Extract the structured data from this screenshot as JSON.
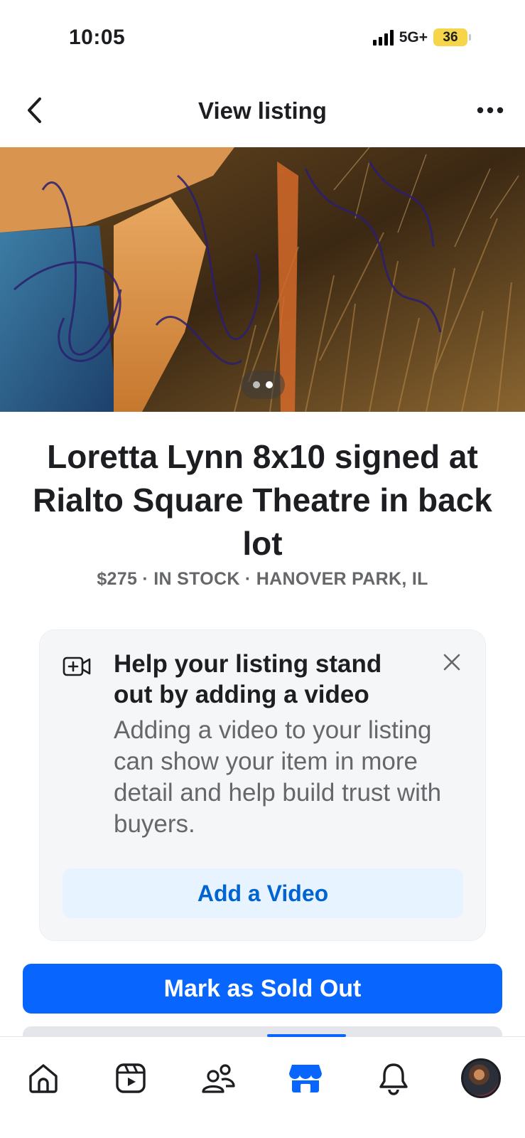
{
  "status_bar": {
    "time": "10:05",
    "network": "5G+",
    "battery": "36"
  },
  "header": {
    "title": "View listing",
    "back_icon": "chevron-left-icon",
    "more_icon": "more-dots-icon"
  },
  "photo": {
    "page_count": 2,
    "active_page": 2
  },
  "listing": {
    "title": "Loretta Lynn 8x10 signed at Rialto Square Theatre in back lot",
    "meta": "$275 · IN STOCK · HANOVER PARK, IL"
  },
  "video_prompt": {
    "icon": "add-video-icon",
    "title": "Help your listing stand out by adding a video",
    "body": "Adding a video to your listing can show your item in more detail and help build trust with buyers.",
    "button_label": "Add a Video",
    "close_icon": "close-icon"
  },
  "actions": {
    "mark_sold_label": "Mark as Sold Out"
  },
  "bottom_nav": {
    "items": [
      {
        "name": "home",
        "icon": "home-icon",
        "active": false
      },
      {
        "name": "video",
        "icon": "video-icon",
        "active": false
      },
      {
        "name": "friends",
        "icon": "friends-icon",
        "active": false
      },
      {
        "name": "marketplace",
        "icon": "marketplace-icon",
        "active": true
      },
      {
        "name": "notifications",
        "icon": "bell-icon",
        "active": false
      },
      {
        "name": "profile",
        "icon": "profile-avatar",
        "active": false
      }
    ]
  },
  "colors": {
    "accent": "#0866ff",
    "accent_text": "#0064d1",
    "secondary_text": "#65676b",
    "card_bg": "#f5f6f7",
    "battery": "#f6d54a"
  }
}
